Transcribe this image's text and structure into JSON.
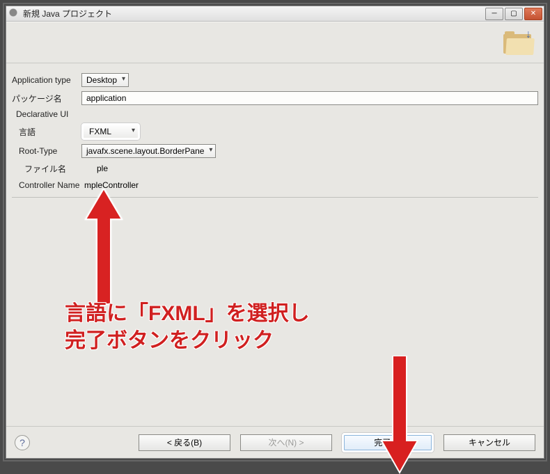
{
  "titlebar": {
    "title": "新規 Java プロジェクト"
  },
  "form": {
    "app_type_label": "Application type",
    "app_type_value": "Desktop",
    "package_label": "パッケージ名",
    "package_value": "application",
    "declarative_ui_label": "Declarative UI",
    "language_label": "言語",
    "language_value": "FXML",
    "root_type_label": "Root-Type",
    "root_type_value": "javafx.scene.layout.BorderPane",
    "file_label": "ファイル名",
    "file_value": "ple",
    "controller_label": "Controller Name",
    "controller_value": "mpleController"
  },
  "annotation": {
    "line1": "言語に「FXML」を選択し",
    "line2": "完了ボタンをクリック"
  },
  "buttons": {
    "back": "< 戻る(B)",
    "next": "次へ(N) >",
    "finish": "完了(F)",
    "cancel": "キャンセル",
    "help": "?"
  }
}
